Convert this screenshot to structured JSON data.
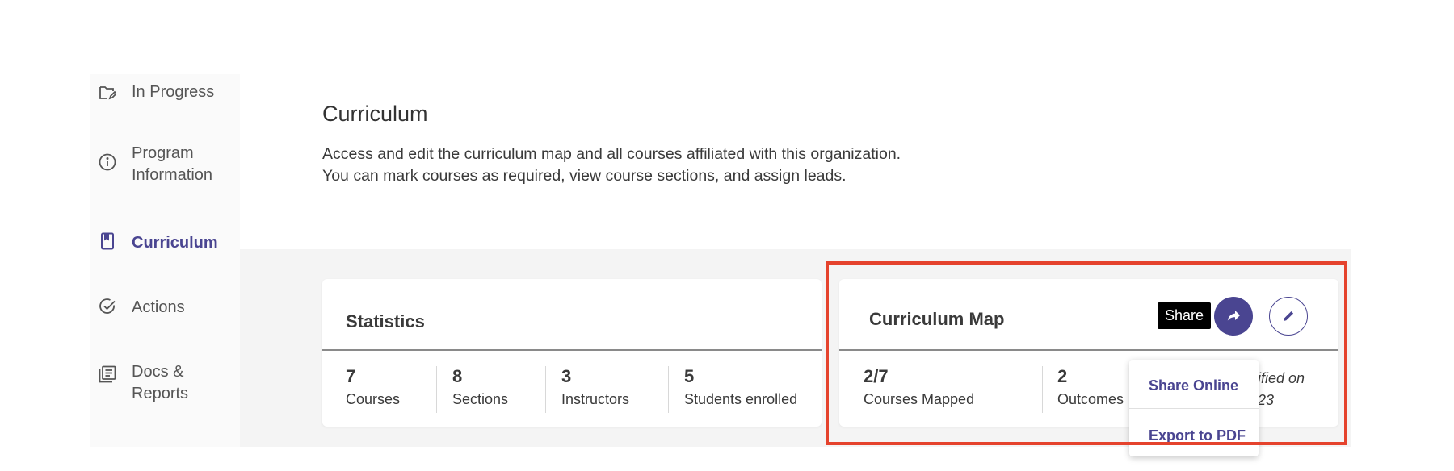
{
  "sidebar": {
    "items": [
      {
        "label": "In Progress",
        "icon": "folder-edit-icon",
        "active": false
      },
      {
        "label": "Program\nInformation",
        "icon": "info-icon",
        "active": false
      },
      {
        "label": "Curriculum",
        "icon": "book-icon",
        "active": true
      },
      {
        "label": "Actions",
        "icon": "check-circle-icon",
        "active": false
      },
      {
        "label": "Docs &\nReports",
        "icon": "documents-icon",
        "active": false
      }
    ]
  },
  "header": {
    "title": "Curriculum",
    "description": "Access and edit the curriculum map and all courses affiliated with this organization. You can mark courses as required, view course sections, and assign leads."
  },
  "statistics": {
    "title": "Statistics",
    "items": [
      {
        "value": "7",
        "label": "Courses"
      },
      {
        "value": "8",
        "label": "Sections"
      },
      {
        "value": "3",
        "label": "Instructors"
      },
      {
        "value": "5",
        "label": "Students enrolled"
      }
    ]
  },
  "curriculum_map": {
    "title": "Curriculum Map",
    "share_tooltip": "Share",
    "items": [
      {
        "value": "2/7",
        "label": "Courses Mapped"
      },
      {
        "value": "2",
        "label": "Outcomes"
      }
    ],
    "modified_line1": "dified on",
    "modified_line2": "23"
  },
  "share_menu": {
    "items": [
      "Share Online",
      "Export to PDF"
    ]
  },
  "colors": {
    "accent": "#4a4591",
    "highlight": "#e5432d"
  }
}
